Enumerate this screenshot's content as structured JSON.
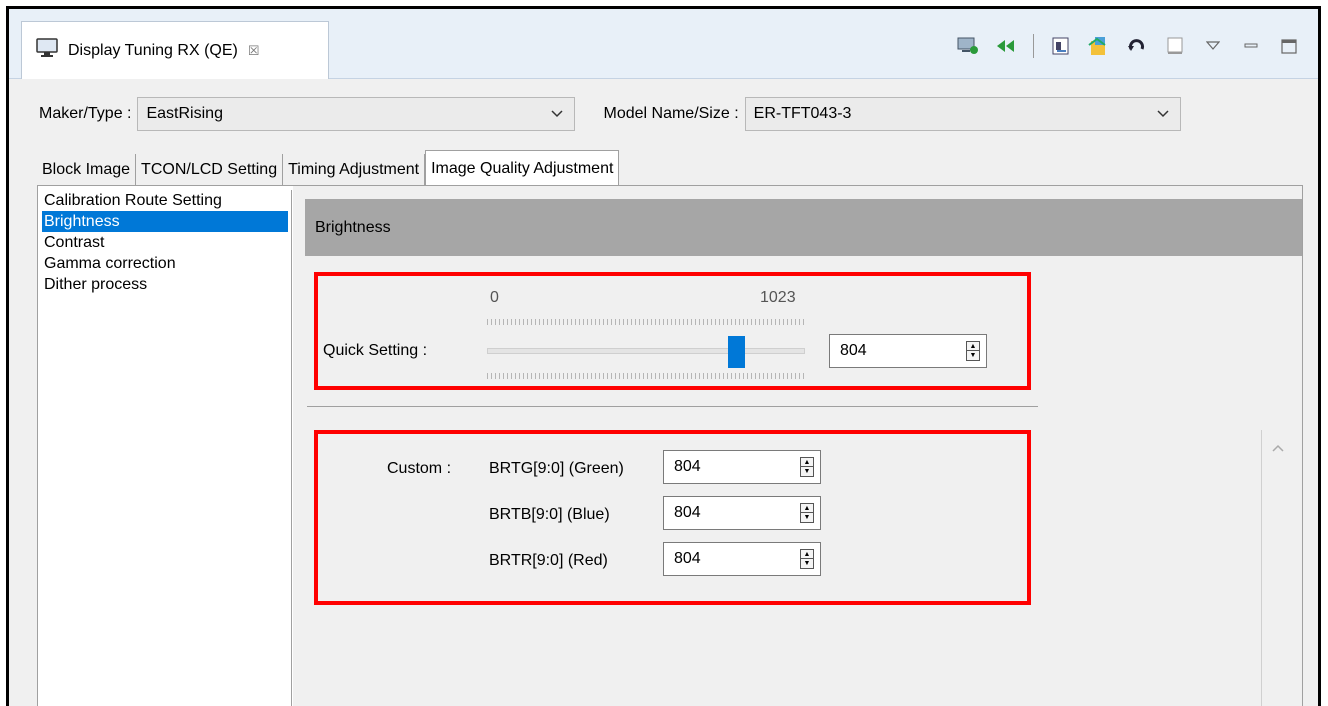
{
  "view_tab": {
    "title": "Display Tuning RX (QE)",
    "close_glyph": "☒",
    "icon": "monitor-icon"
  },
  "toolbar": {
    "icons": [
      "connect-icon",
      "rewind-icon",
      "export-icon",
      "settings-wizard-icon",
      "refresh-icon",
      "minimize-panel-icon",
      "view-menu-icon",
      "minimize-icon",
      "maximize-icon"
    ]
  },
  "maker": {
    "label": "Maker/Type :",
    "value": "EastRising"
  },
  "model": {
    "label": "Model Name/Size :",
    "value": "ER-TFT043-3"
  },
  "tabs": [
    {
      "label": "Block Image",
      "active": false
    },
    {
      "label": "TCON/LCD Setting",
      "active": false
    },
    {
      "label": "Timing Adjustment",
      "active": false
    },
    {
      "label": "Image Quality Adjustment",
      "active": true
    }
  ],
  "nav": {
    "items": [
      {
        "label": "Calibration Route Setting",
        "selected": false
      },
      {
        "label": "Brightness",
        "selected": true
      },
      {
        "label": "Contrast",
        "selected": false
      },
      {
        "label": "Gamma correction",
        "selected": false
      },
      {
        "label": "Dither process",
        "selected": false
      }
    ]
  },
  "section": {
    "title": "Brightness"
  },
  "quick_setting": {
    "label": "Quick Setting :",
    "min": "0",
    "max": "1023",
    "value": "804",
    "slider_fraction": 0.786
  },
  "custom": {
    "label": "Custom :",
    "fields": [
      {
        "label": "BRTG[9:0] (Green)",
        "value": "804"
      },
      {
        "label": "BRTB[9:0] (Blue)",
        "value": "804"
      },
      {
        "label": "BRTR[9:0] (Red)",
        "value": "804"
      }
    ]
  },
  "colors": {
    "highlight": "#ff0000",
    "selection": "#0078d7",
    "header_gray": "#a6a6a6"
  }
}
